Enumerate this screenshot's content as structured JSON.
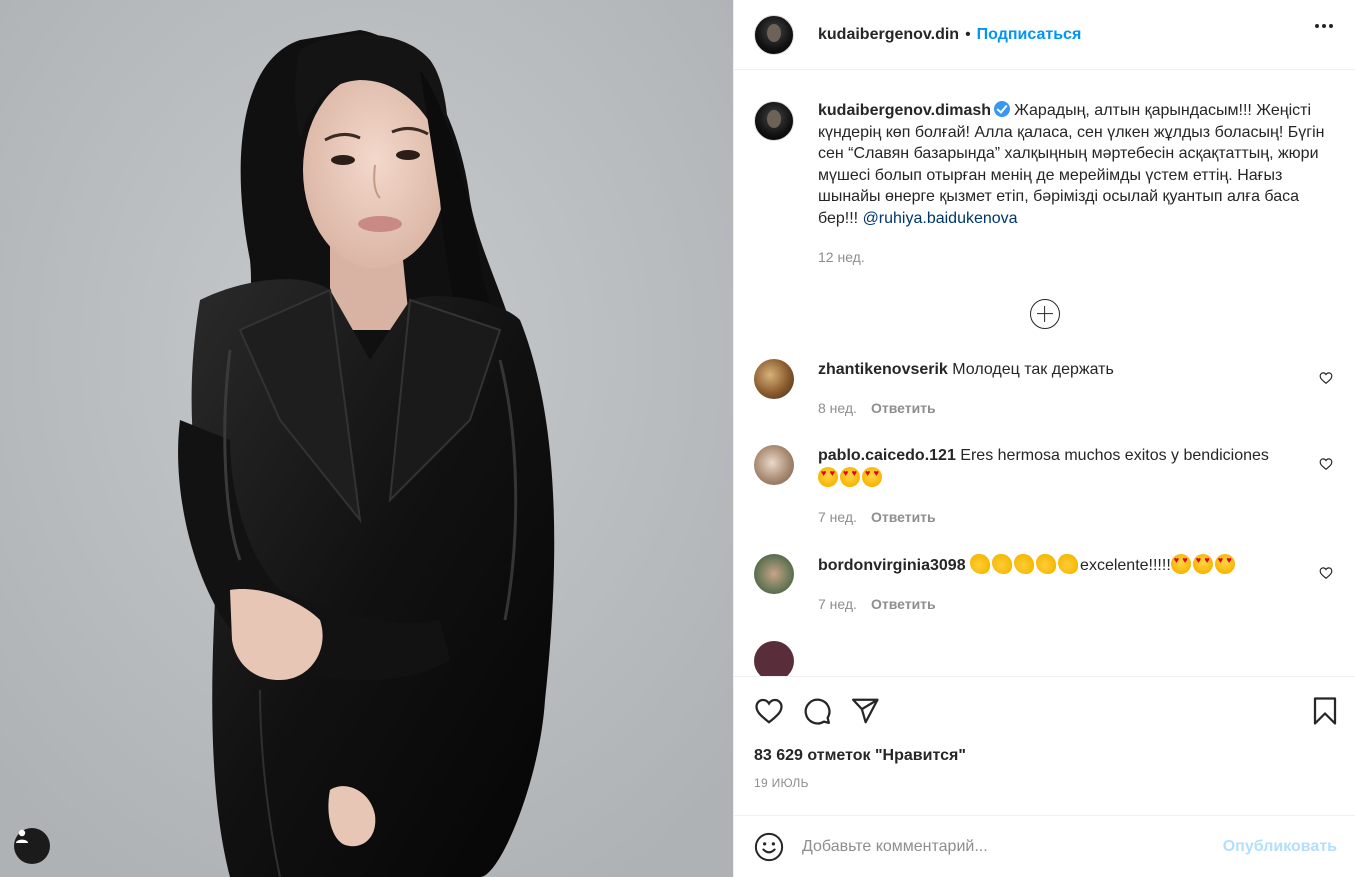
{
  "header": {
    "username": "kudaibergenov.din",
    "separator": "•",
    "follow_label": "Подписаться"
  },
  "caption": {
    "username": "kudaibergenov.dimash",
    "text": "Жарадың, алтын қарындасым!!! Жеңісті күндерің көп болғай! Алла қаласа, сен үлкен жұлдыз боласың! Бүгін сен “Славян базарында” халқыңның мәртебесін асқақтаттың, жюри мүшесі болып отырған менің де мерейімды үстем еттің. Нағыз шынайы өнерге қызмет етіп, бәрімізді осылай қуантып алға баса бер!!! ",
    "mention": "@ruhiya.baidukenova",
    "time": "12 нед."
  },
  "comments": [
    {
      "username": "zhantikenovserik",
      "text": "Молодец так держать",
      "time": "8 нед.",
      "reply_label": "Ответить"
    },
    {
      "username": "pablo.caicedo.121",
      "text": "Eres hermosa muchos exitos y bendiciones",
      "time": "7 нед.",
      "reply_label": "Ответить"
    },
    {
      "username": "bordonvirginia3098",
      "text": "excelente!!!!!",
      "time": "7 нед.",
      "reply_label": "Ответить"
    }
  ],
  "actions": {
    "likes": "83 629 отметок \"Нравится\"",
    "date": "19 ИЮЛЬ"
  },
  "add_comment": {
    "placeholder": "Добавьте комментарий...",
    "publish_label": "Опубликовать"
  },
  "colors": {
    "accent": "#0095f6",
    "publish_disabled": "#b2dffc",
    "muted": "#8e8e8e",
    "mention": "#00376b"
  },
  "icons": [
    "user-tag-icon",
    "more-options-icon",
    "verified-badge-icon",
    "load-more-icon",
    "heart-icon",
    "comment-icon",
    "share-icon",
    "bookmark-icon",
    "emoji-icon"
  ]
}
